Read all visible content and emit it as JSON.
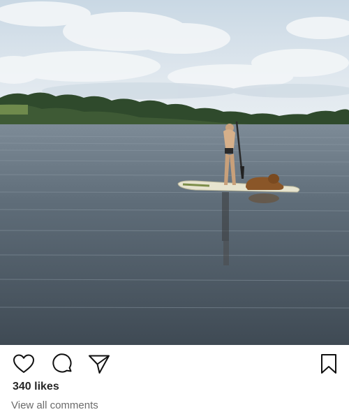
{
  "post": {
    "image_alt": "",
    "likes_text": "340 likes",
    "view_comments_text": "View all comments"
  },
  "icons": {
    "like": "heart-icon",
    "comment": "comment-icon",
    "share": "send-icon",
    "save": "bookmark-icon"
  }
}
